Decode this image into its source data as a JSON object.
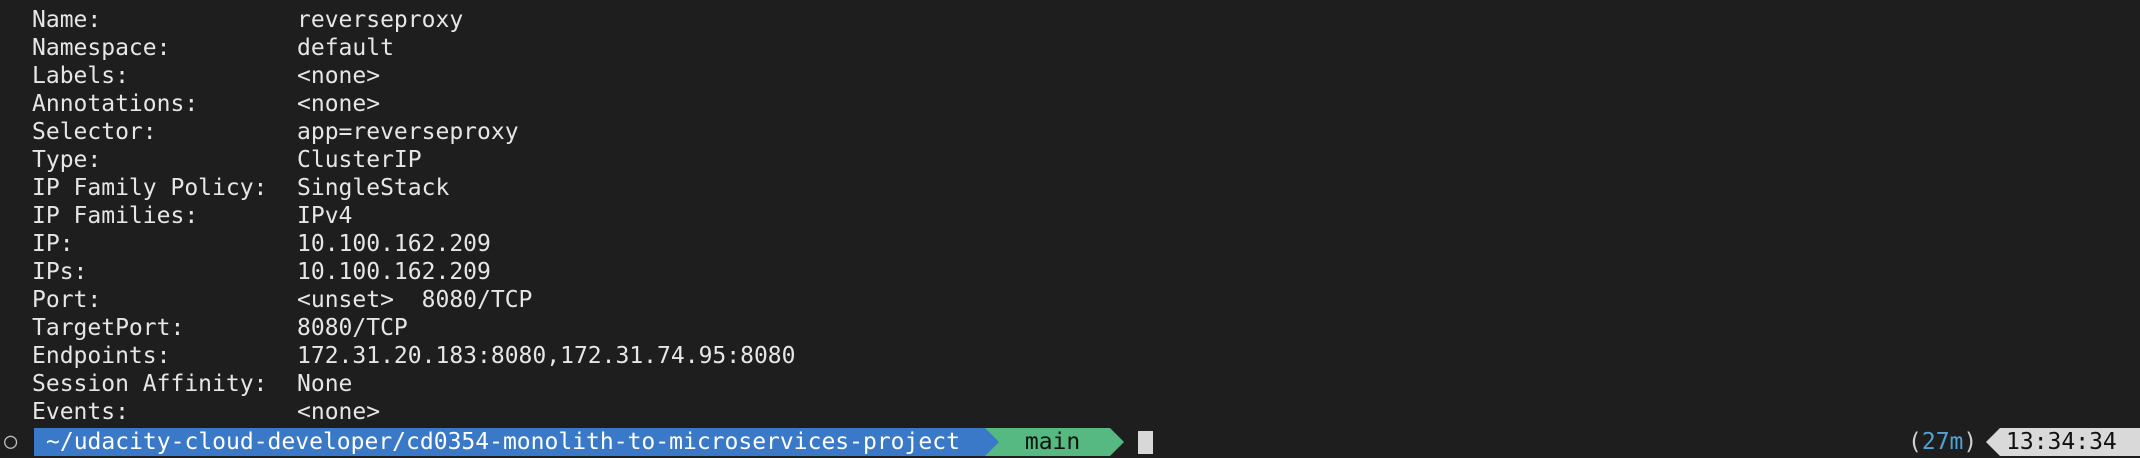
{
  "describe": {
    "rows": [
      {
        "key": "Name:",
        "value": "reverseproxy"
      },
      {
        "key": "Namespace:",
        "value": "default"
      },
      {
        "key": "Labels:",
        "value": "<none>"
      },
      {
        "key": "Annotations:",
        "value": "<none>"
      },
      {
        "key": "Selector:",
        "value": "app=reverseproxy"
      },
      {
        "key": "Type:",
        "value": "ClusterIP"
      },
      {
        "key": "IP Family Policy:",
        "value": "SingleStack"
      },
      {
        "key": "IP Families:",
        "value": "IPv4"
      },
      {
        "key": "IP:",
        "value": "10.100.162.209"
      },
      {
        "key": "IPs:",
        "value": "10.100.162.209"
      },
      {
        "key": "Port:",
        "value": "<unset>  8080/TCP"
      },
      {
        "key": "TargetPort:",
        "value": "8080/TCP"
      },
      {
        "key": "Endpoints:",
        "value": "172.31.20.183:8080,172.31.74.95:8080"
      },
      {
        "key": "Session Affinity:",
        "value": "None"
      },
      {
        "key": "Events:",
        "value": "<none>"
      }
    ]
  },
  "prompt": {
    "status_glyph": "○",
    "path": "~/udacity-cloud-developer/cd0354-monolith-to-microservices-project",
    "git_icon": "branch-icon",
    "git_glyph": "",
    "branch": "main",
    "elapsed_open": "(",
    "elapsed_value": "27m",
    "elapsed_close": ")",
    "time": "13:34:34"
  },
  "colors": {
    "background": "#1e1e1e",
    "text": "#e6e6e6",
    "path_segment": "#3a78c8",
    "git_segment": "#55b981",
    "time_segment": "#d9d9d9",
    "elapsed_accent": "#4fa3d8"
  }
}
